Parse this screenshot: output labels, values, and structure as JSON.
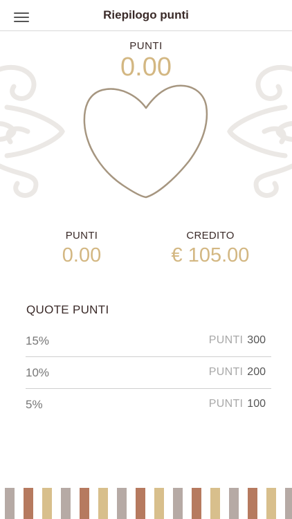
{
  "header": {
    "title": "Riepilogo punti",
    "menu_icon": "hamburger-menu-icon"
  },
  "summary": {
    "points_label": "PUNTI",
    "points_value": "0.00"
  },
  "stats": {
    "points_label": "PUNTI",
    "points_value": "0.00",
    "credit_label": "CREDITO",
    "credit_value": "€ 105.00"
  },
  "quotes": {
    "title": "QUOTE PUNTI",
    "rows": [
      {
        "percent": "15%",
        "unit": "PUNTI",
        "points": "300"
      },
      {
        "percent": "10%",
        "unit": "PUNTI",
        "points": "200"
      },
      {
        "percent": "5%",
        "unit": "PUNTI",
        "points": "100"
      }
    ]
  },
  "colors": {
    "accent_gold": "#d3b782",
    "heart_stroke": "#a69680",
    "stripe_gray": "#b6aaa5",
    "stripe_brown": "#b67a5f",
    "stripe_gold": "#d8bf8c"
  }
}
